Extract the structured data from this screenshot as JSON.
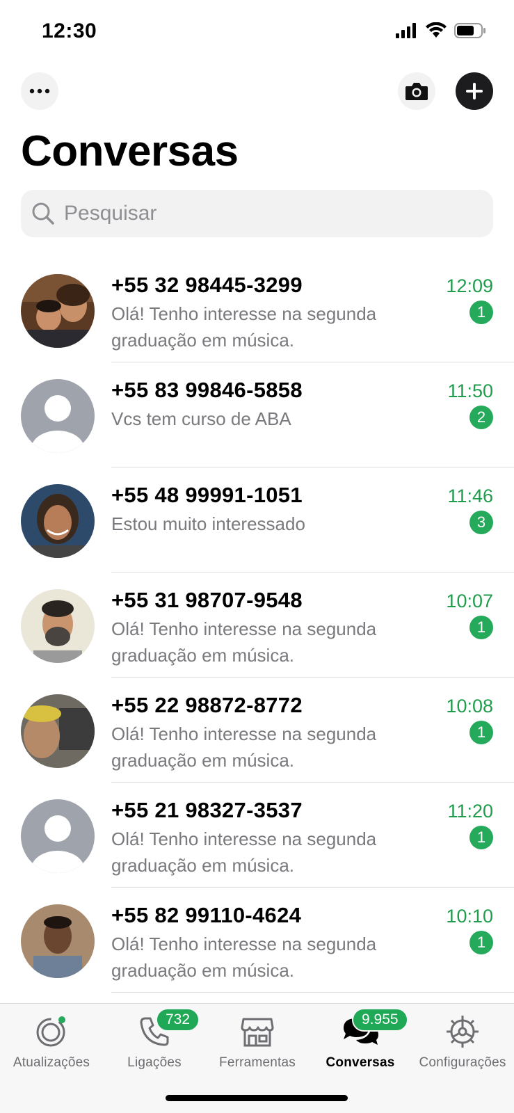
{
  "status_bar": {
    "time": "12:30"
  },
  "header": {
    "title": "Conversas",
    "more_icon": "ellipsis-icon",
    "camera_icon": "camera-icon",
    "add_icon": "plus-icon"
  },
  "search": {
    "placeholder": "Pesquisar"
  },
  "chats": [
    {
      "name": "+55 32 98445-3299",
      "message": "Olá! Tenho interesse na segunda graduação em música.",
      "time": "12:09",
      "unread": "1"
    },
    {
      "name": "+55 83 99846-5858",
      "message": "Vcs tem curso de ABA",
      "time": "11:50",
      "unread": "2"
    },
    {
      "name": "+55 48 99991-1051",
      "message": "Estou muito interessado",
      "time": "11:46",
      "unread": "3"
    },
    {
      "name": "+55 31 98707-9548",
      "message": "Olá! Tenho interesse na segunda graduação em música.",
      "time": "10:07",
      "unread": "1"
    },
    {
      "name": "+55 22 98872-8772",
      "message": "Olá! Tenho interesse na segunda graduação em música.",
      "time": "10:08",
      "unread": "1"
    },
    {
      "name": "+55 21 98327-3537",
      "message": "Olá! Tenho interesse na segunda graduação em música.",
      "time": "11:20",
      "unread": "1"
    },
    {
      "name": "+55 82 99110-4624",
      "message": "Olá! Tenho interesse na segunda graduação em música.",
      "time": "10:10",
      "unread": "1"
    }
  ],
  "tabs": [
    {
      "label": "Atualizações",
      "icon": "status-icon"
    },
    {
      "label": "Ligações",
      "icon": "phone-icon",
      "badge": "732"
    },
    {
      "label": "Ferramentas",
      "icon": "store-icon"
    },
    {
      "label": "Conversas",
      "icon": "chat-bubbles-icon",
      "badge": "9.955",
      "active": true
    },
    {
      "label": "Configurações",
      "icon": "gear-icon"
    }
  ],
  "colors": {
    "accent_green": "#25a95a",
    "time_green": "#1f9c4c"
  }
}
